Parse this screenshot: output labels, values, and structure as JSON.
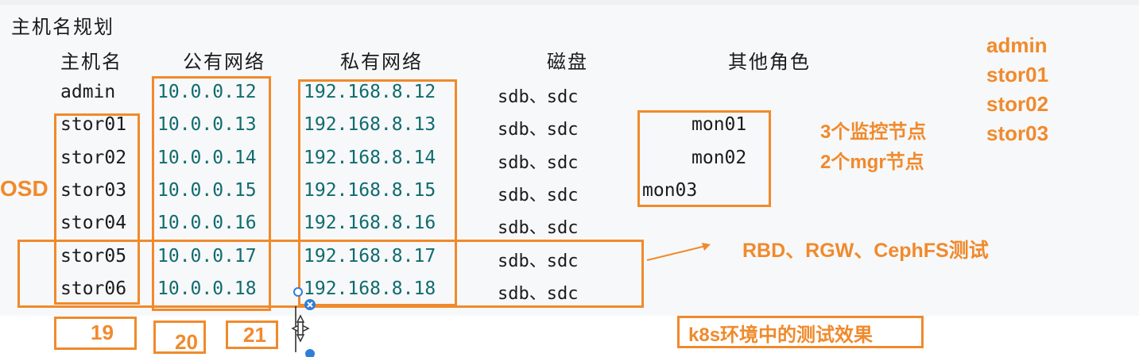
{
  "section_title": "主机名规划",
  "headers": {
    "hostname": "主机名",
    "public": "公有网络",
    "private": "私有网络",
    "disk": "磁盘",
    "roles": "其他角色"
  },
  "rows": [
    {
      "host": "admin",
      "public": "10.0.0.12",
      "private": "192.168.8.12",
      "disk": "sdb、sdc"
    },
    {
      "host": "stor01",
      "public": "10.0.0.13",
      "private": "192.168.8.13",
      "disk": "sdb、sdc"
    },
    {
      "host": "stor02",
      "public": "10.0.0.14",
      "private": "192.168.8.14",
      "disk": "sdb、sdc"
    },
    {
      "host": "stor03",
      "public": "10.0.0.15",
      "private": "192.168.8.15",
      "disk": "sdb、sdc"
    },
    {
      "host": "stor04",
      "public": "10.0.0.16",
      "private": "192.168.8.16",
      "disk": "sdb、sdc"
    },
    {
      "host": "stor05",
      "public": "10.0.0.17",
      "private": "192.168.8.17",
      "disk": "sdb、sdc"
    },
    {
      "host": "stor06",
      "public": "10.0.0.18",
      "private": "192.168.8.18",
      "disk": "sdb、sdc"
    }
  ],
  "roles": [
    "mon01",
    "mon02",
    "mon03"
  ],
  "annotations": {
    "osd": "OSD",
    "monitor_nodes": "3个监控节点",
    "mgr_nodes": "2个mgr节点",
    "rbd_test": "RBD、RGW、CephFS测试",
    "k8s_test": "k8s环境中的测试效果",
    "admin_list": [
      "admin",
      "stor01",
      "stor02",
      "stor03"
    ],
    "counts": [
      "19",
      "20",
      "21"
    ]
  },
  "colors": {
    "accent": "#f08a2c",
    "ip_text": "#0f6b6f",
    "handle": "#2f7fd6"
  }
}
